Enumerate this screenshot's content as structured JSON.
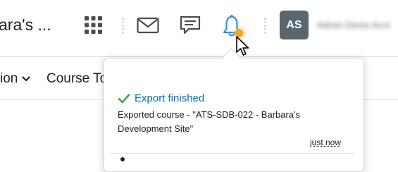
{
  "header": {
    "site_title": "ara's ...",
    "avatar_initials": "AS",
    "username": "Admin Demo Acct"
  },
  "nav": {
    "items": [
      "ion",
      "Course To"
    ]
  },
  "notification": {
    "title": "Export finished",
    "body": "Exported course - \"ATS-SDB-022 - Barbara's Development Site\"",
    "time": "just now"
  },
  "icons": {
    "waffle": "grid-icon",
    "mail": "envelope-icon",
    "chat": "chat-bubble-icon",
    "bell": "bell-icon",
    "check": "checkmark-icon",
    "cursor": "mouse-pointer-icon"
  },
  "colors": {
    "link_blue": "#006fbf",
    "check_green": "#46a661",
    "avatar_bg": "#59656f",
    "bell_blue": "#2b8ee6",
    "bell_badge": "#f1a91c"
  }
}
